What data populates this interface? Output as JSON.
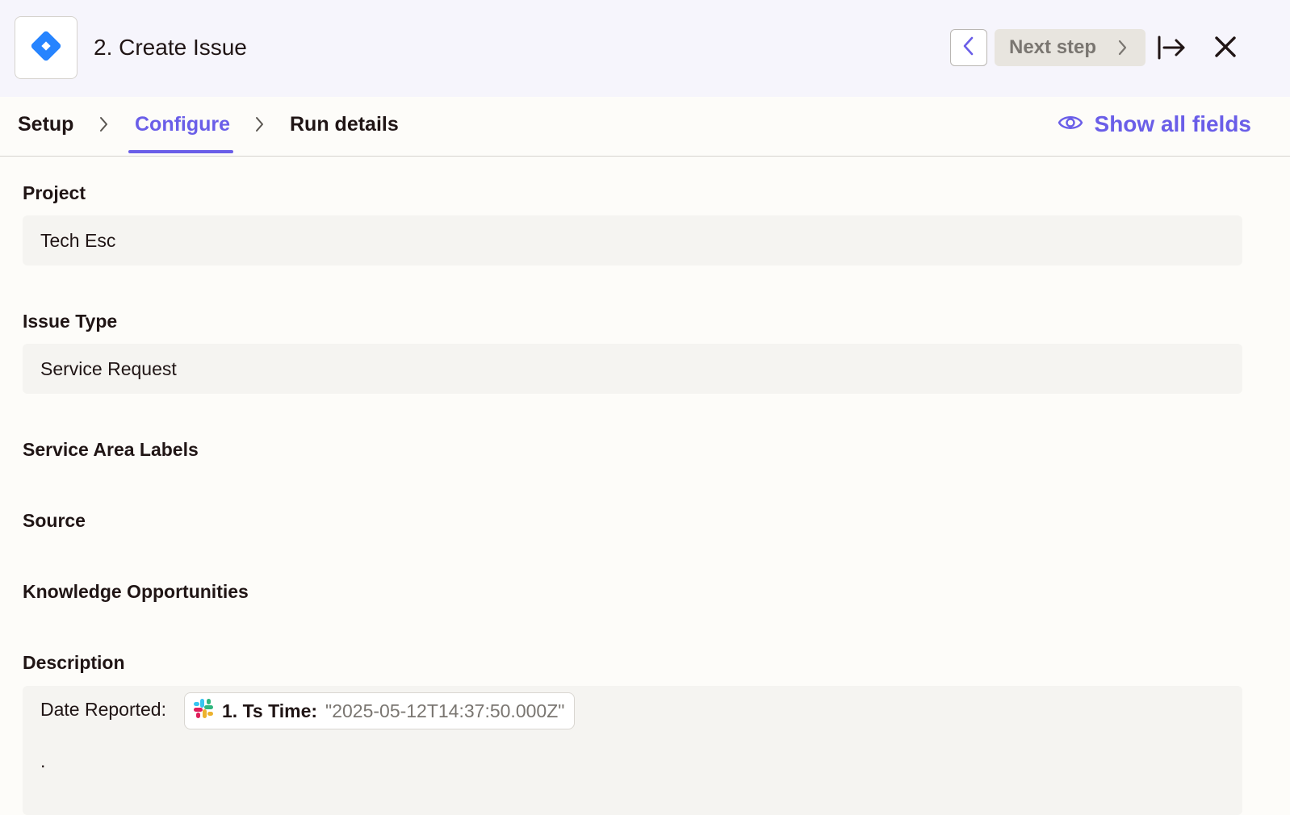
{
  "header": {
    "app_icon": "jira-icon",
    "step_title": "2. Create Issue",
    "prev_icon": "chevron-left-icon",
    "next_label": "Next step",
    "next_icon": "chevron-right-icon",
    "collapse_icon": "collapse-panel-icon",
    "close_icon": "close-icon"
  },
  "tabs": {
    "items": [
      {
        "label": "Setup",
        "active": false
      },
      {
        "label": "Configure",
        "active": true
      },
      {
        "label": "Run details",
        "active": false
      }
    ],
    "separator_icon": "chevron-right-icon",
    "show_all_label": "Show all fields",
    "show_all_icon": "eye-icon"
  },
  "form": {
    "project": {
      "label": "Project",
      "value": "Tech Esc"
    },
    "issue_type": {
      "label": "Issue Type",
      "value": "Service Request"
    },
    "service_area_labels": {
      "label": "Service Area Labels"
    },
    "source": {
      "label": "Source"
    },
    "knowledge_opportunities": {
      "label": "Knowledge Opportunities"
    },
    "description": {
      "label": "Description",
      "prefix": "Date Reported:",
      "pill_icon": "slack-icon",
      "pill_label": "1. Ts Time:",
      "pill_value": "\"2025-05-12T14:37:50.000Z\"",
      "trailing": "."
    }
  },
  "colors": {
    "accent": "#6a5ee8",
    "header_bg": "#f6f5fc",
    "page_bg": "#fdfcf9",
    "field_bg": "#f5f4f1",
    "jira_blue": "#2684ff"
  }
}
